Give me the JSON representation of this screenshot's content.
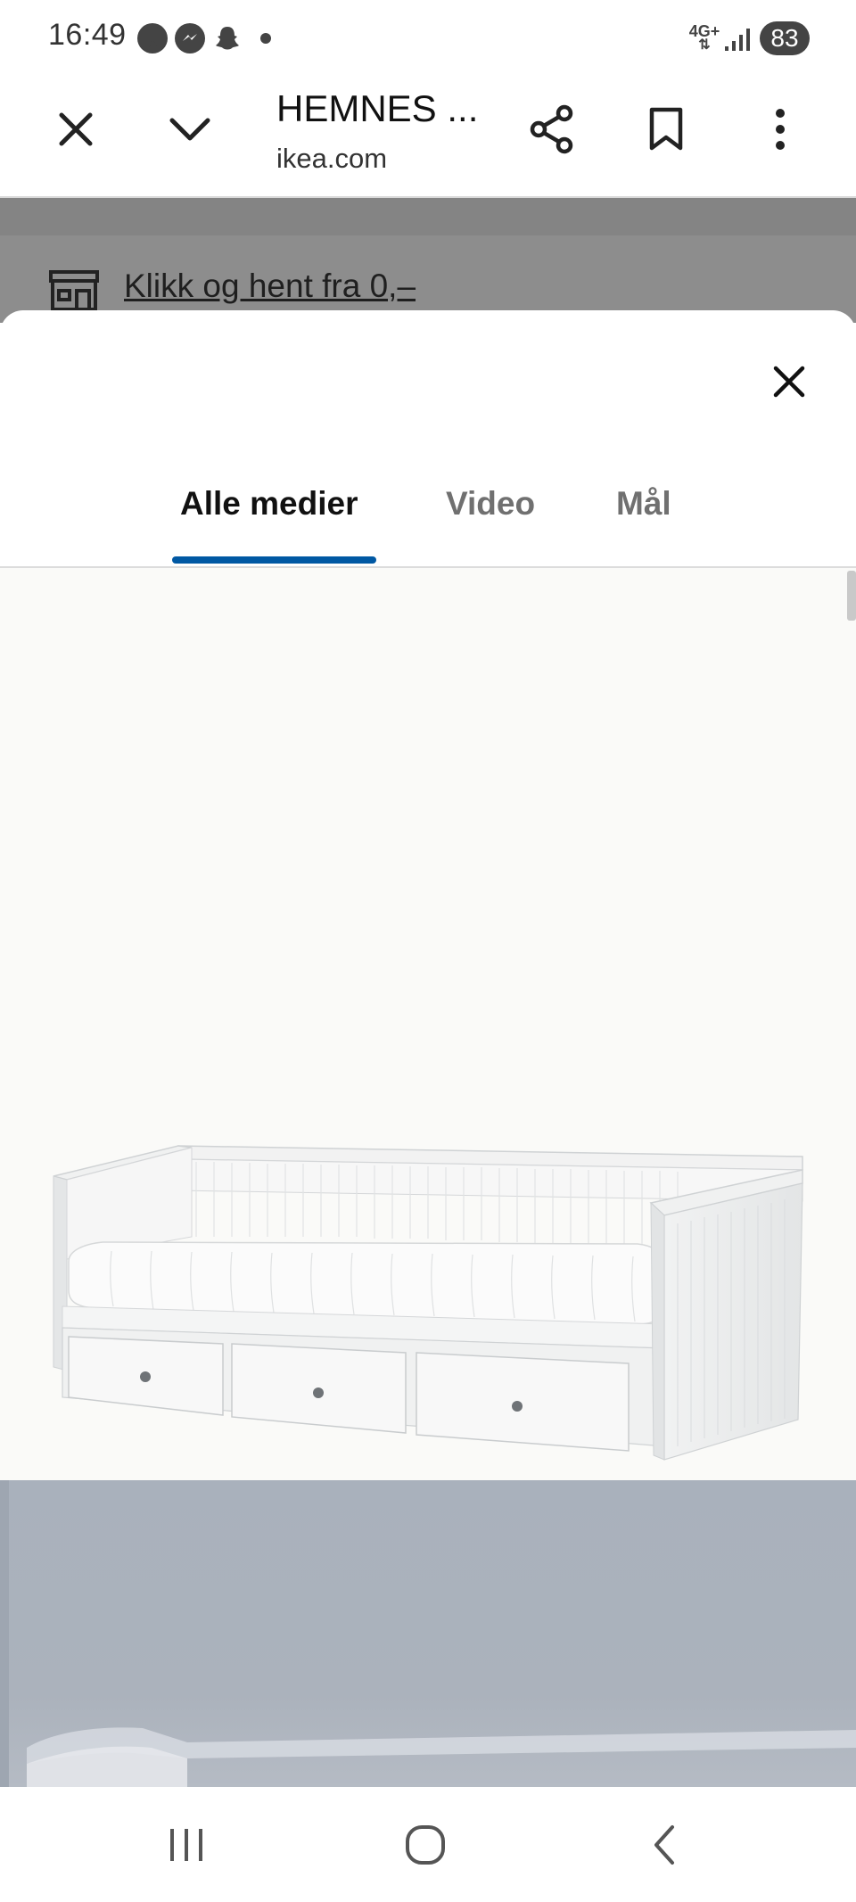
{
  "status_bar": {
    "time": "16:49",
    "notification_icons": [
      "accessibility-icon",
      "messenger-icon",
      "snapchat-icon",
      "more-dot-icon"
    ],
    "network_label": "4G+",
    "battery_level": "83"
  },
  "browser": {
    "title": "HEMNES ...",
    "domain": "ikea.com",
    "icons": [
      "close-icon",
      "chevron-down-icon",
      "share-icon",
      "bookmark-icon",
      "more-vert-icon"
    ]
  },
  "page_behind": {
    "promo_text": "Klikk og hent fra 0,–"
  },
  "media_modal": {
    "tabs": [
      {
        "label": "Alle medier",
        "active": true
      },
      {
        "label": "Video",
        "active": false
      },
      {
        "label": "Mål",
        "active": false
      }
    ],
    "colors": {
      "active_tab_underline": "#0058a3",
      "inactive_tab_text": "#707070"
    }
  },
  "nav_bar": {
    "icons": [
      "recent-apps-icon",
      "home-icon",
      "back-icon"
    ]
  }
}
